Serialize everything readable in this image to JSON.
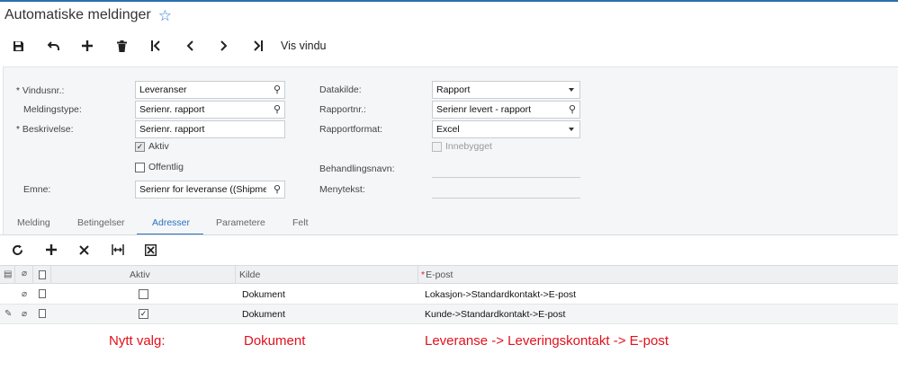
{
  "window": {
    "title": "Automatiske meldinger",
    "favorite_icon": "star-outline-icon"
  },
  "toolbar": {
    "buttons": [
      {
        "name": "save-icon",
        "glyph": "💾"
      },
      {
        "name": "undo-icon",
        "glyph": "↶"
      },
      {
        "name": "add-icon",
        "glyph": "+"
      },
      {
        "name": "delete-icon",
        "glyph": "🗑"
      },
      {
        "name": "first-record-icon",
        "glyph": "|<"
      },
      {
        "name": "previous-record-icon",
        "glyph": "<"
      },
      {
        "name": "next-record-icon",
        "glyph": ">"
      },
      {
        "name": "last-record-icon",
        "glyph": ">|"
      }
    ],
    "view_window_label": "Vis vindu"
  },
  "form": {
    "window_no": {
      "label": "Vindusnr.:",
      "value": "Leveranser"
    },
    "message_type": {
      "label": "Meldingstype:",
      "value": "Serienr. rapport"
    },
    "description": {
      "label": "Beskrivelse:",
      "value": "Serienr. rapport"
    },
    "active": {
      "label": "Aktiv",
      "checked": true
    },
    "public": {
      "label": "Offentlig",
      "checked": false
    },
    "subject": {
      "label": "Emne:",
      "value": "Serienr for leveranse  ((Shipmen"
    },
    "data_source": {
      "label": "Datakilde:",
      "value": "Rapport"
    },
    "report_no": {
      "label": "Rapportnr.:",
      "value": "Serienr levert - rapport"
    },
    "report_format": {
      "label": "Rapportformat:",
      "value": "Excel"
    },
    "embedded": {
      "label": "Innebygget",
      "checked": false
    },
    "handler_name": {
      "label": "Behandlingsnavn:",
      "value": ""
    },
    "menu_text": {
      "label": "Menytekst:",
      "value": ""
    }
  },
  "tabs": [
    {
      "label": "Melding",
      "active": false
    },
    {
      "label": "Betingelser",
      "active": false
    },
    {
      "label": "Adresser",
      "active": true
    },
    {
      "label": "Parametere",
      "active": false
    },
    {
      "label": "Felt",
      "active": false
    }
  ],
  "grid_toolbar": {
    "buttons": [
      {
        "name": "refresh-icon",
        "glyph": "↻"
      },
      {
        "name": "add-row-icon",
        "glyph": "+"
      },
      {
        "name": "delete-row-icon",
        "glyph": "✕"
      },
      {
        "name": "fit-columns-icon",
        "glyph": "|↔|"
      },
      {
        "name": "export-excel-icon",
        "glyph": "⊠"
      }
    ]
  },
  "grid": {
    "columns": {
      "active": "Aktiv",
      "source": "Kilde",
      "email_required": "*",
      "email": "E-post"
    },
    "rows": [
      {
        "active": false,
        "source": "Dokument",
        "email": "Lokasjon->Standardkontakt->E-post",
        "editing": false
      },
      {
        "active": true,
        "source": "Dokument",
        "email": "Kunde->Standardkontakt->E-post",
        "editing": true
      }
    ]
  },
  "annotation": {
    "label": "Nytt valg:",
    "source": "Dokument",
    "email": "Leveranse -> Leveringskontakt -> E-post",
    "color": "#e0111b"
  },
  "colors": {
    "accent": "#2a72c2",
    "panel": "#f5f6f7"
  }
}
